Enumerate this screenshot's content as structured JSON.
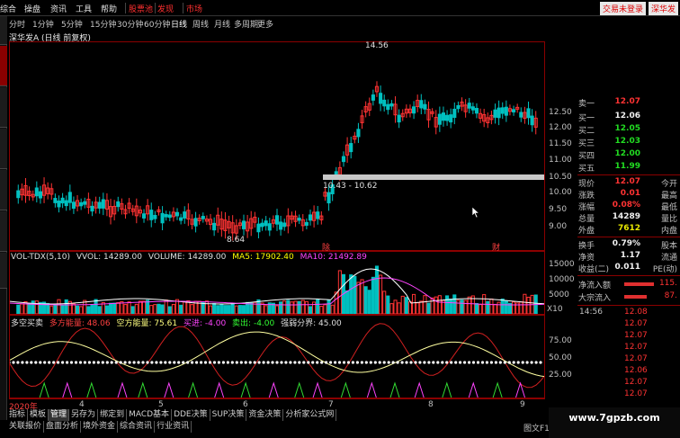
{
  "menubar": {
    "items": [
      "综合",
      "操盘",
      "资讯",
      "工具",
      "帮助",
      "股票池",
      "发现",
      "市场"
    ],
    "login": [
      "交易未登录",
      "深华发"
    ]
  },
  "periods": [
    "分时",
    "1分钟",
    "5分钟",
    "15分钟",
    "30分钟",
    "60分钟",
    "日线",
    "周线",
    "月线",
    "多周期",
    "更多"
  ],
  "active_period": "日线",
  "stock_title": "深华发A (日线 前复权)",
  "price_axis": [
    "12.50",
    "12.00",
    "11.50",
    "11.00",
    "10.50",
    "10.00",
    "9.50",
    "9.00"
  ],
  "vol_axis": [
    "15000",
    "10000",
    "5000"
  ],
  "vol_unit": "X10",
  "osc_axis": [
    "75.00",
    "50.00",
    "25.00"
  ],
  "annotations": {
    "high": "14.56",
    "low": "8.64",
    "range_box": "10.43 - 10.62",
    "mark1": "除",
    "mark2": "财"
  },
  "vol_legend": {
    "name": "VOL-TDX(5,10)",
    "vvol": "VVOL: 14289.00",
    "volume": "VOLUME: 14289.00",
    "ma5": "MA5: 17902.40",
    "ma10": "MA10: 21492.89"
  },
  "osc_legend": {
    "name": "多空买卖",
    "long": "多方能量: 48.06",
    "short": "空方能量: 75.61",
    "buy": "买进: -4.00",
    "sell": "卖出: -4.00",
    "weak": "强弱分界: 45.00"
  },
  "dates": [
    "2020年",
    "4",
    "5",
    "6",
    "7",
    "8",
    "9"
  ],
  "tabs1": [
    "指标",
    "模板",
    "管理",
    "另存为",
    "绑定到",
    "MACD基本",
    "DDE决策",
    "SUP决策",
    "资金决策",
    "分析家公式网"
  ],
  "tabs2": [
    "关联报价",
    "盘面分析",
    "境外资金",
    "综合资讯",
    "行业资讯"
  ],
  "quote": {
    "sell": [
      {
        "label": "卖一",
        "price": "12.07"
      }
    ],
    "buy": [
      {
        "label": "买一",
        "price": "12.06",
        "color": "white"
      },
      {
        "label": "买二",
        "price": "12.05",
        "color": "green"
      },
      {
        "label": "买三",
        "price": "12.03",
        "color": "green"
      },
      {
        "label": "买四",
        "price": "12.00",
        "color": "green"
      },
      {
        "label": "买五",
        "price": "11.99",
        "color": "green"
      }
    ],
    "stats": [
      {
        "l1": "现价",
        "v1": "12.07",
        "c1": "red",
        "l2": "今开"
      },
      {
        "l1": "涨跌",
        "v1": "0.01",
        "c1": "red",
        "l2": "最高"
      },
      {
        "l1": "涨幅",
        "v1": "0.08%",
        "c1": "red",
        "l2": "最低"
      },
      {
        "l1": "总量",
        "v1": "14289",
        "c1": "white",
        "l2": "量比"
      },
      {
        "l1": "外盘",
        "v1": "7612",
        "c1": "yellow",
        "l2": "内盘"
      }
    ],
    "stats2": [
      {
        "l1": "换手",
        "v1": "0.79%",
        "c1": "white",
        "l2": "股本"
      },
      {
        "l1": "净资",
        "v1": "1.17",
        "c1": "white",
        "l2": "流通"
      },
      {
        "l1": "收益(二)",
        "v1": "0.011",
        "c1": "white",
        "l2": "PE(动)"
      }
    ],
    "flows": [
      {
        "label": "净流入额",
        "value": "115.",
        "bar": 0.55
      },
      {
        "label": "大宗流入",
        "value": "87.",
        "bar": 0.42
      }
    ]
  },
  "ticks": [
    {
      "time": "14:56",
      "price": "12.08"
    },
    {
      "time": "",
      "price": "12.07"
    },
    {
      "time": "",
      "price": "12.07"
    },
    {
      "time": "",
      "price": "12.07"
    },
    {
      "time": "",
      "price": "12.07"
    },
    {
      "time": "",
      "price": "12.06"
    },
    {
      "time": "",
      "price": "12.07"
    },
    {
      "time": "",
      "price": "12.07"
    }
  ],
  "status": "图文F10",
  "watermark": "www.7gpzb.com",
  "colors": {
    "up": "#ff3333",
    "down": "#00c0c0",
    "frame": "#8b0000",
    "ma_white": "#ffffff",
    "ma_yellow": "#ffff00",
    "ma_magenta": "#ff44ff"
  }
}
